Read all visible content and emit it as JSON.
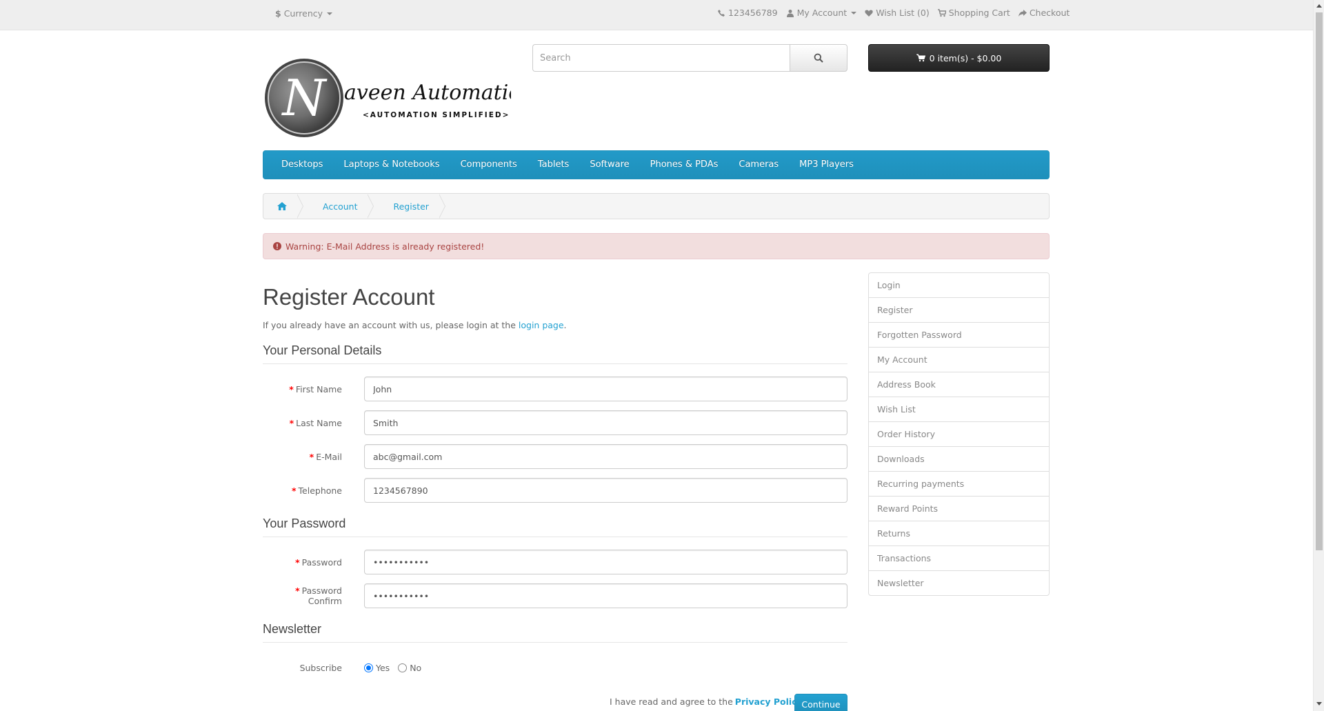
{
  "topbar": {
    "currency_symbol": "$",
    "currency_label": "Currency",
    "phone": "123456789",
    "my_account": "My Account",
    "wish_list": "Wish List (0)",
    "shopping_cart": "Shopping Cart",
    "checkout": "Checkout"
  },
  "header": {
    "logo_text": "aveen Automation Labs",
    "logo_letter": "N",
    "logo_tagline": "<AUTOMATION SIMPLIFIED>",
    "search_placeholder": "Search",
    "cart_label": "0 item(s) - $0.00"
  },
  "menu": {
    "items": [
      "Desktops",
      "Laptops & Notebooks",
      "Components",
      "Tablets",
      "Software",
      "Phones & PDAs",
      "Cameras",
      "MP3 Players"
    ]
  },
  "breadcrumb": {
    "items": [
      "Account",
      "Register"
    ]
  },
  "alert": {
    "text": "Warning: E-Mail Address is already registered!"
  },
  "main": {
    "title": "Register Account",
    "intro_prefix": "If you already have an account with us, please login at the ",
    "intro_link": "login page",
    "intro_suffix": ".",
    "personal_legend": "Your Personal Details",
    "password_legend": "Your Password",
    "newsletter_legend": "Newsletter",
    "fields": {
      "firstname": {
        "label": "First Name",
        "value": "John"
      },
      "lastname": {
        "label": "Last Name",
        "value": "Smith"
      },
      "email": {
        "label": "E-Mail",
        "value": "abc@gmail.com"
      },
      "telephone": {
        "label": "Telephone",
        "value": "1234567890"
      },
      "password": {
        "label": "Password",
        "value": "•••••••••••"
      },
      "confirm": {
        "label": "Password Confirm",
        "value": "•••••••••••"
      }
    },
    "subscribe_label": "Subscribe",
    "subscribe_yes": "Yes",
    "subscribe_no": "No",
    "subscribe_selected": "Yes",
    "agree_prefix": "I have read and agree to the ",
    "agree_link": "Privacy Policy",
    "agree_checked": true,
    "continue_label": "Continue"
  },
  "sidebar": {
    "items": [
      "Login",
      "Register",
      "Forgotten Password",
      "My Account",
      "Address Book",
      "Wish List",
      "Order History",
      "Downloads",
      "Recurring payments",
      "Reward Points",
      "Returns",
      "Transactions",
      "Newsletter"
    ]
  },
  "colors": {
    "accent": "#229ac8",
    "link": "#23a1d1",
    "alert_bg": "#f2dede",
    "alert_text": "#a94442"
  }
}
